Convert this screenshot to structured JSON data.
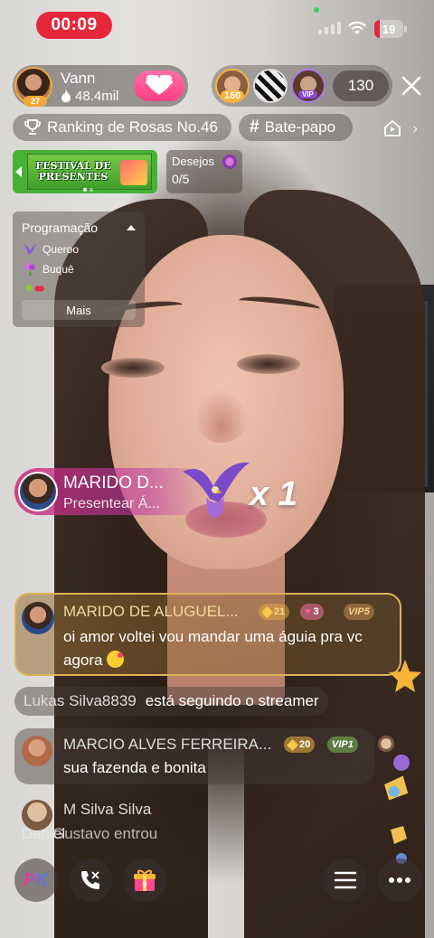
{
  "status_bar": {
    "recording_time": "00:09",
    "battery_level": "19",
    "battery_color": "#e5273c"
  },
  "host": {
    "name": "Vann",
    "level": "27",
    "followers": "48.4mil",
    "follow_icon": "heart-icon"
  },
  "viewers": {
    "top1_badge": "160",
    "top3_badge": "VIP",
    "count": "130"
  },
  "tags": {
    "ranking": "Ranking de Rosas No.46",
    "chat": "Bate-papo"
  },
  "banner": {
    "festival_text": "FESTIVAL DE PRESENTES",
    "wishes_label": "Desejos",
    "wishes_count": "0/5"
  },
  "programming": {
    "title": "Programação",
    "items": [
      {
        "label": "Queroo",
        "icon": "eagle-icon"
      },
      {
        "label": "Buquê",
        "icon": "bouquet-icon"
      },
      {
        "label": "",
        "icon": "fruit-icon"
      }
    ],
    "more_label": "Mais"
  },
  "gift_notice": {
    "sender": "MARIDO D...",
    "action": "Presentear Á...",
    "combo": "x 1"
  },
  "chat": {
    "highlight": {
      "name": "MARIDO DE ALUGUEL...",
      "badge_level": "21",
      "badge_heart": "3",
      "badge_vip": "VIP5",
      "text": "oi amor voltei vou mandar uma águia pra vc agora"
    },
    "follow_notice": {
      "user": "Lukas Silva8839",
      "text": "está seguindo o streamer"
    },
    "message2": {
      "name": "MARCIO ALVES FERREIRA...",
      "badge_level": "20",
      "badge_vip": "VIP1",
      "text": "sua fazenda e bonita"
    },
    "message3": {
      "name": "M Silva Silva"
    },
    "entry_notice_a": "Daniel",
    "entry_notice_b": "Gustavo entrou"
  },
  "bottom_bar": {
    "pk_label": "PK"
  },
  "colors": {
    "accent_pink": "#ff3e86",
    "accent_red": "#e5273c",
    "gold": "#d9b25a"
  }
}
